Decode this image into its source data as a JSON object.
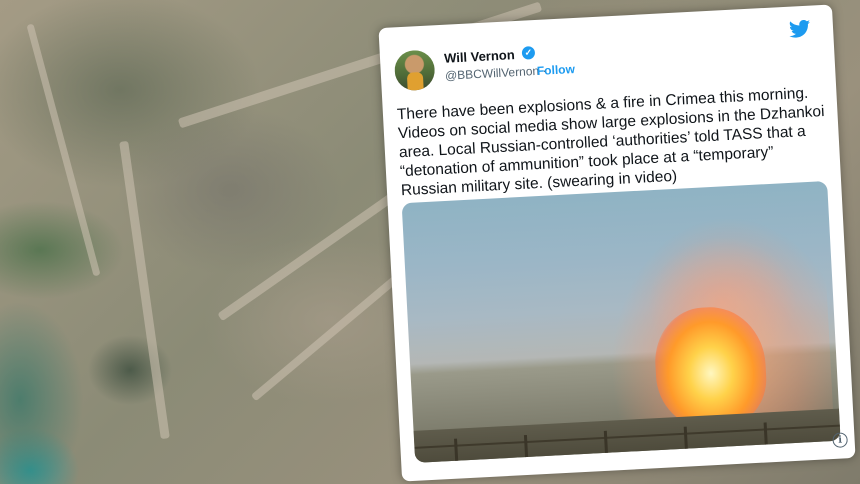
{
  "tweet": {
    "author_name": "Will Vernon",
    "author_handle": "@BBCWillVernon",
    "handle_separator": "·",
    "follow_label": "Follow",
    "text": "There have been explosions & a fire in Crimea this morning. Videos on social media show large explosions in the Dzhankoi area. Local Russian-controlled ‘authorities’ told TASS that a “detonation of ammunition” took place at a “temporary” Russian military site. (swearing in video)",
    "verified_glyph": "✓",
    "info_glyph": "i"
  },
  "icons": {
    "brand": "twitter-bird-icon",
    "verified": "verified-badge-icon",
    "info": "info-icon"
  },
  "colors": {
    "accent": "#1d9bf0",
    "text": "#0f1419",
    "muted": "#536471"
  }
}
